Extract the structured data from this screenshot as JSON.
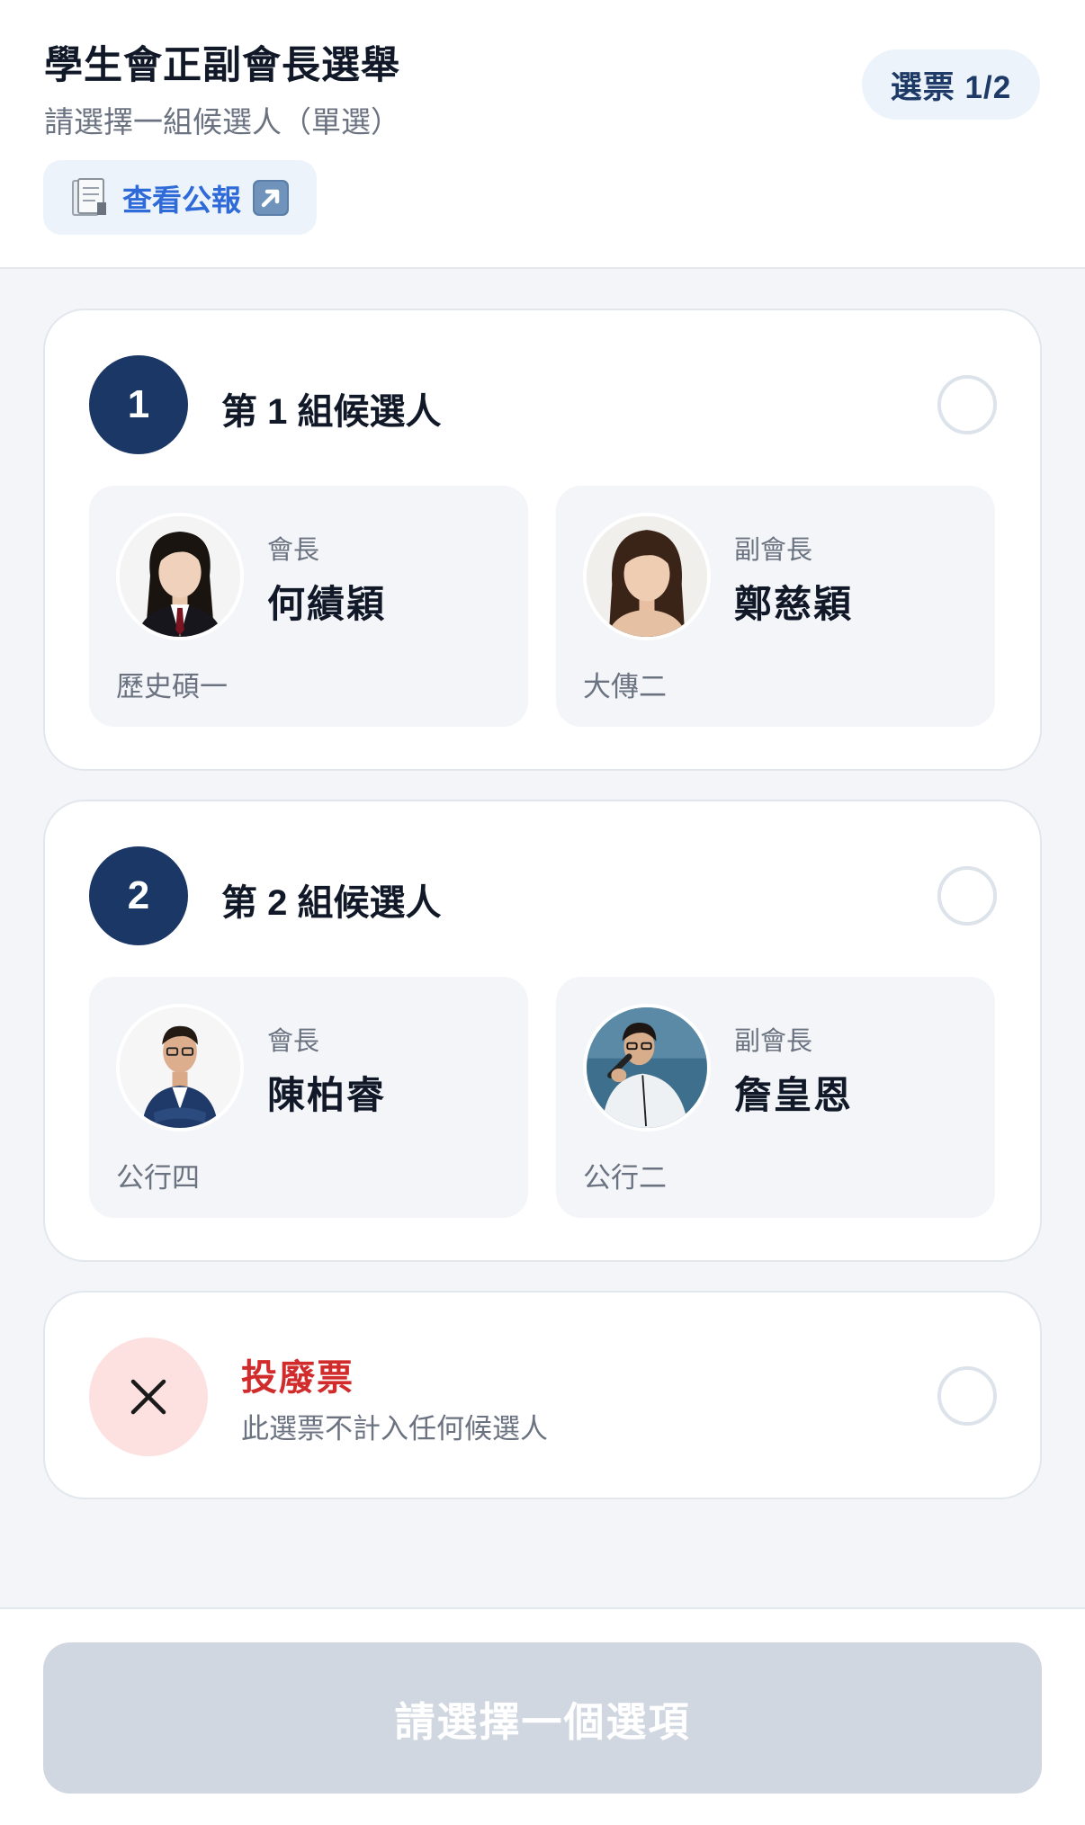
{
  "header": {
    "title": "學生會正副會長選舉",
    "subtitle": "請選擇一組候選人（單選）",
    "bulletin_label": "查看公報",
    "ballot_label": "選票 1/2"
  },
  "groups": [
    {
      "number": "1",
      "title": "第 1 組候選人",
      "candidates": [
        {
          "role": "會長",
          "name": "何績穎",
          "dept": "歷史碩一"
        },
        {
          "role": "副會長",
          "name": "鄭慈穎",
          "dept": "大傳二"
        }
      ]
    },
    {
      "number": "2",
      "title": "第 2 組候選人",
      "candidates": [
        {
          "role": "會長",
          "name": "陳柏睿",
          "dept": "公行四"
        },
        {
          "role": "副會長",
          "name": "詹皇恩",
          "dept": "公行二"
        }
      ]
    }
  ],
  "invalid_vote": {
    "title": "投廢票",
    "description": "此選票不計入任何候選人"
  },
  "submit": {
    "label": "請選擇一個選項"
  },
  "colors": {
    "primary": "#1a3766",
    "accent_blue": "#2f6bd8",
    "danger": "#d12b2b",
    "disabled": "#d1d7e0"
  }
}
